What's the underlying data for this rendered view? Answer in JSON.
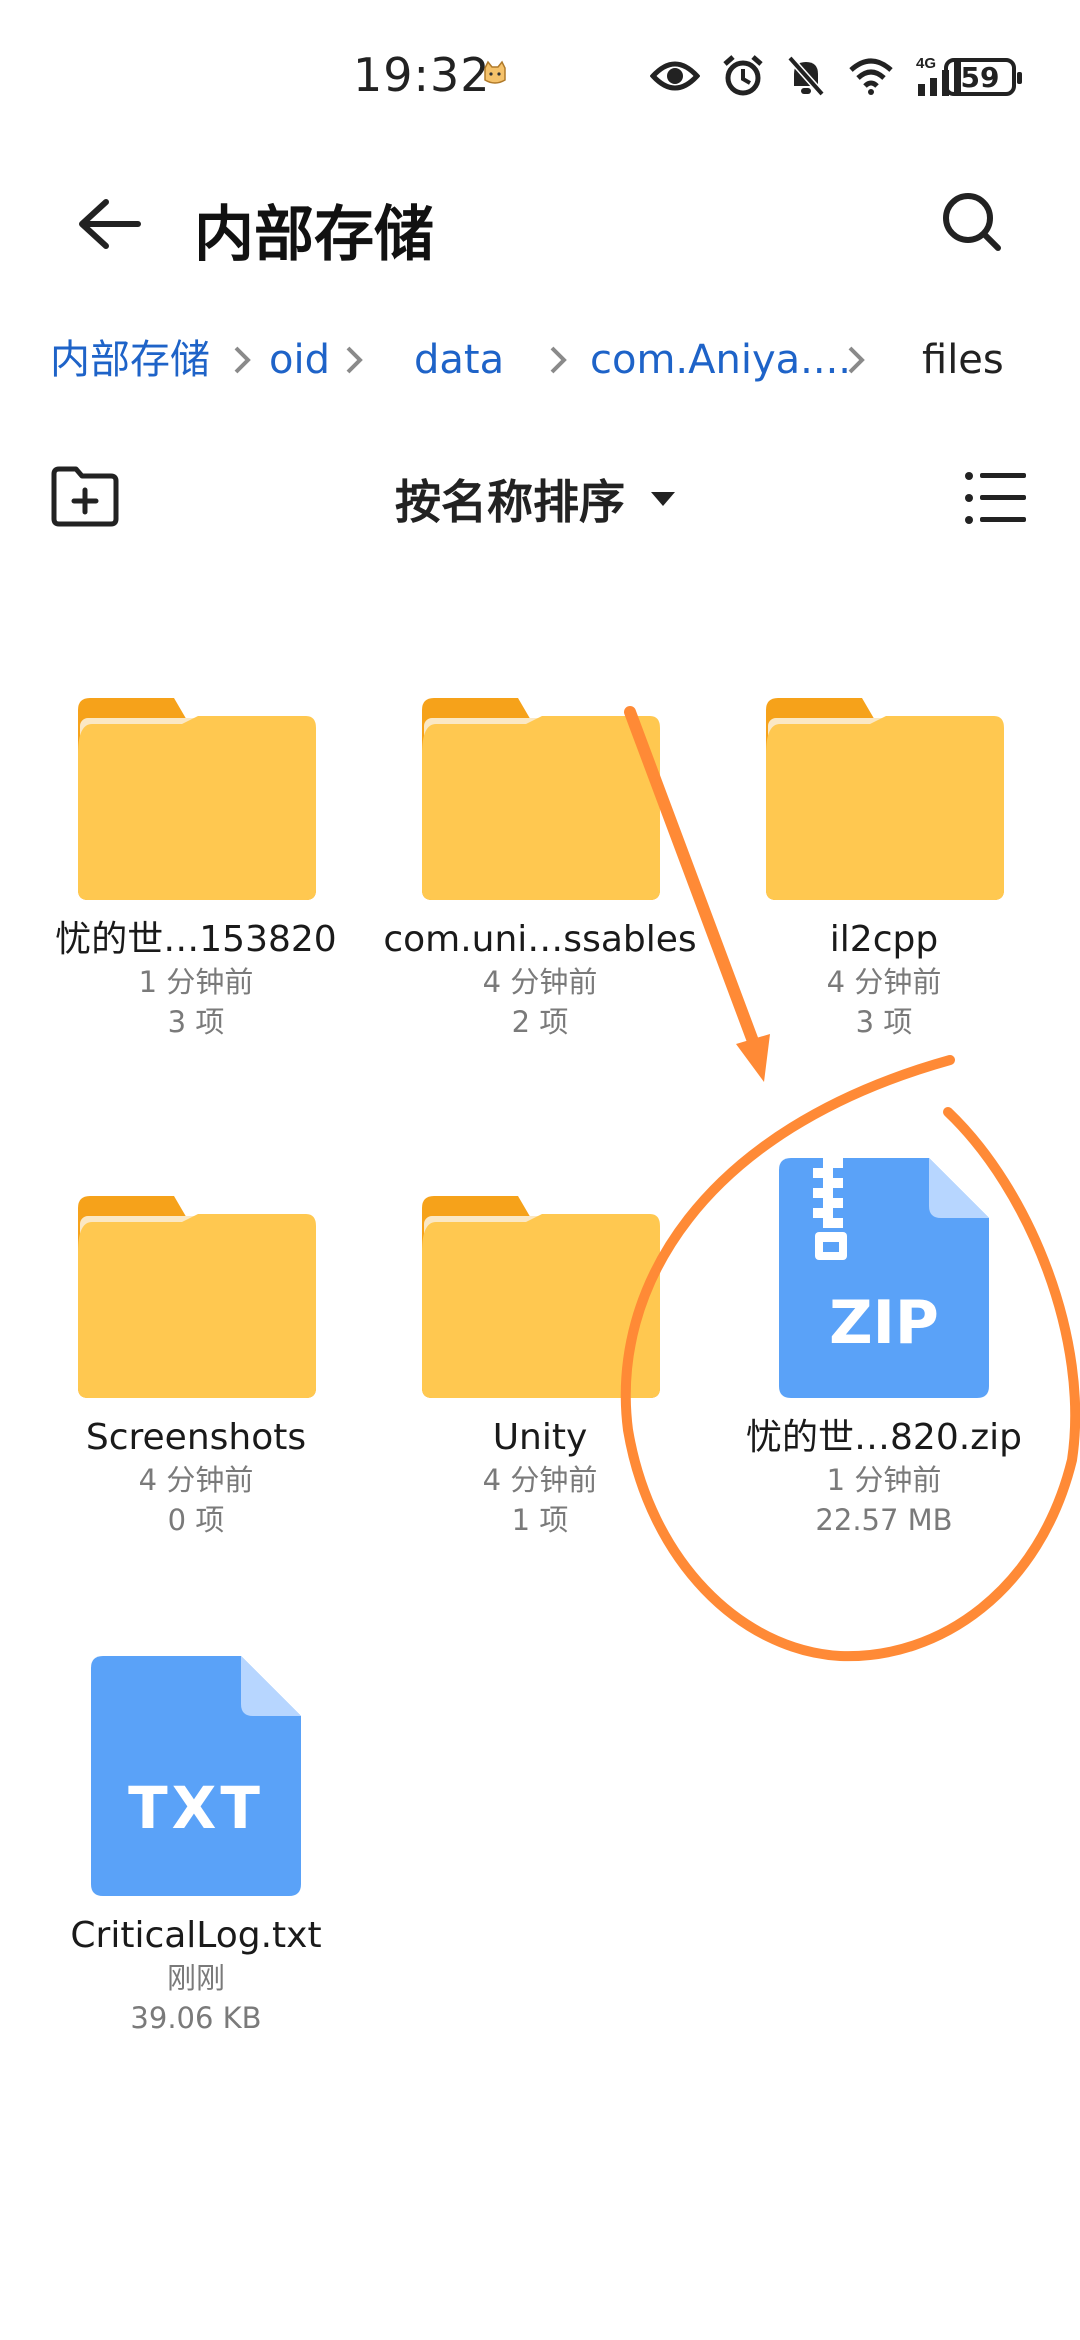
{
  "status_bar": {
    "time": "19:32",
    "battery": "59",
    "icons": [
      "eye-icon",
      "alarm-icon",
      "bell-off-icon",
      "wifi-icon",
      "signal-4g-icon"
    ],
    "network_label": "4G"
  },
  "header": {
    "title": "内部存储"
  },
  "breadcrumb": [
    {
      "label": "内部存储",
      "current": false
    },
    {
      "label": "oid",
      "current": false
    },
    {
      "label": "data",
      "current": false
    },
    {
      "label": "com.Aniya....",
      "current": false
    },
    {
      "label": "files",
      "current": true
    }
  ],
  "toolbar": {
    "sort_label": "按名称排序"
  },
  "items": [
    {
      "type": "folder",
      "name": "忧的世…153820",
      "time": "1 分钟前",
      "detail": "3 项"
    },
    {
      "type": "folder",
      "name": "com.uni…ssables",
      "time": "4 分钟前",
      "detail": "2 项"
    },
    {
      "type": "folder",
      "name": "il2cpp",
      "time": "4 分钟前",
      "detail": "3 项"
    },
    {
      "type": "folder",
      "name": "Screenshots",
      "time": "4 分钟前",
      "detail": "0 项"
    },
    {
      "type": "folder",
      "name": "Unity",
      "time": "4 分钟前",
      "detail": "1 项"
    },
    {
      "type": "zip",
      "badge": "ZIP",
      "name": "忧的世…820.zip",
      "time": "1 分钟前",
      "detail": "22.57 MB"
    },
    {
      "type": "txt",
      "badge": "TXT",
      "name": "CriticalLog.txt",
      "time": "刚刚",
      "detail": "39.06 KB"
    }
  ],
  "colors": {
    "accent": "#1e63c8",
    "folder": "#ffc850",
    "folder_tab": "#f6a21a",
    "file_blue": "#5aa2f8",
    "annotation": "#ff8a36"
  }
}
